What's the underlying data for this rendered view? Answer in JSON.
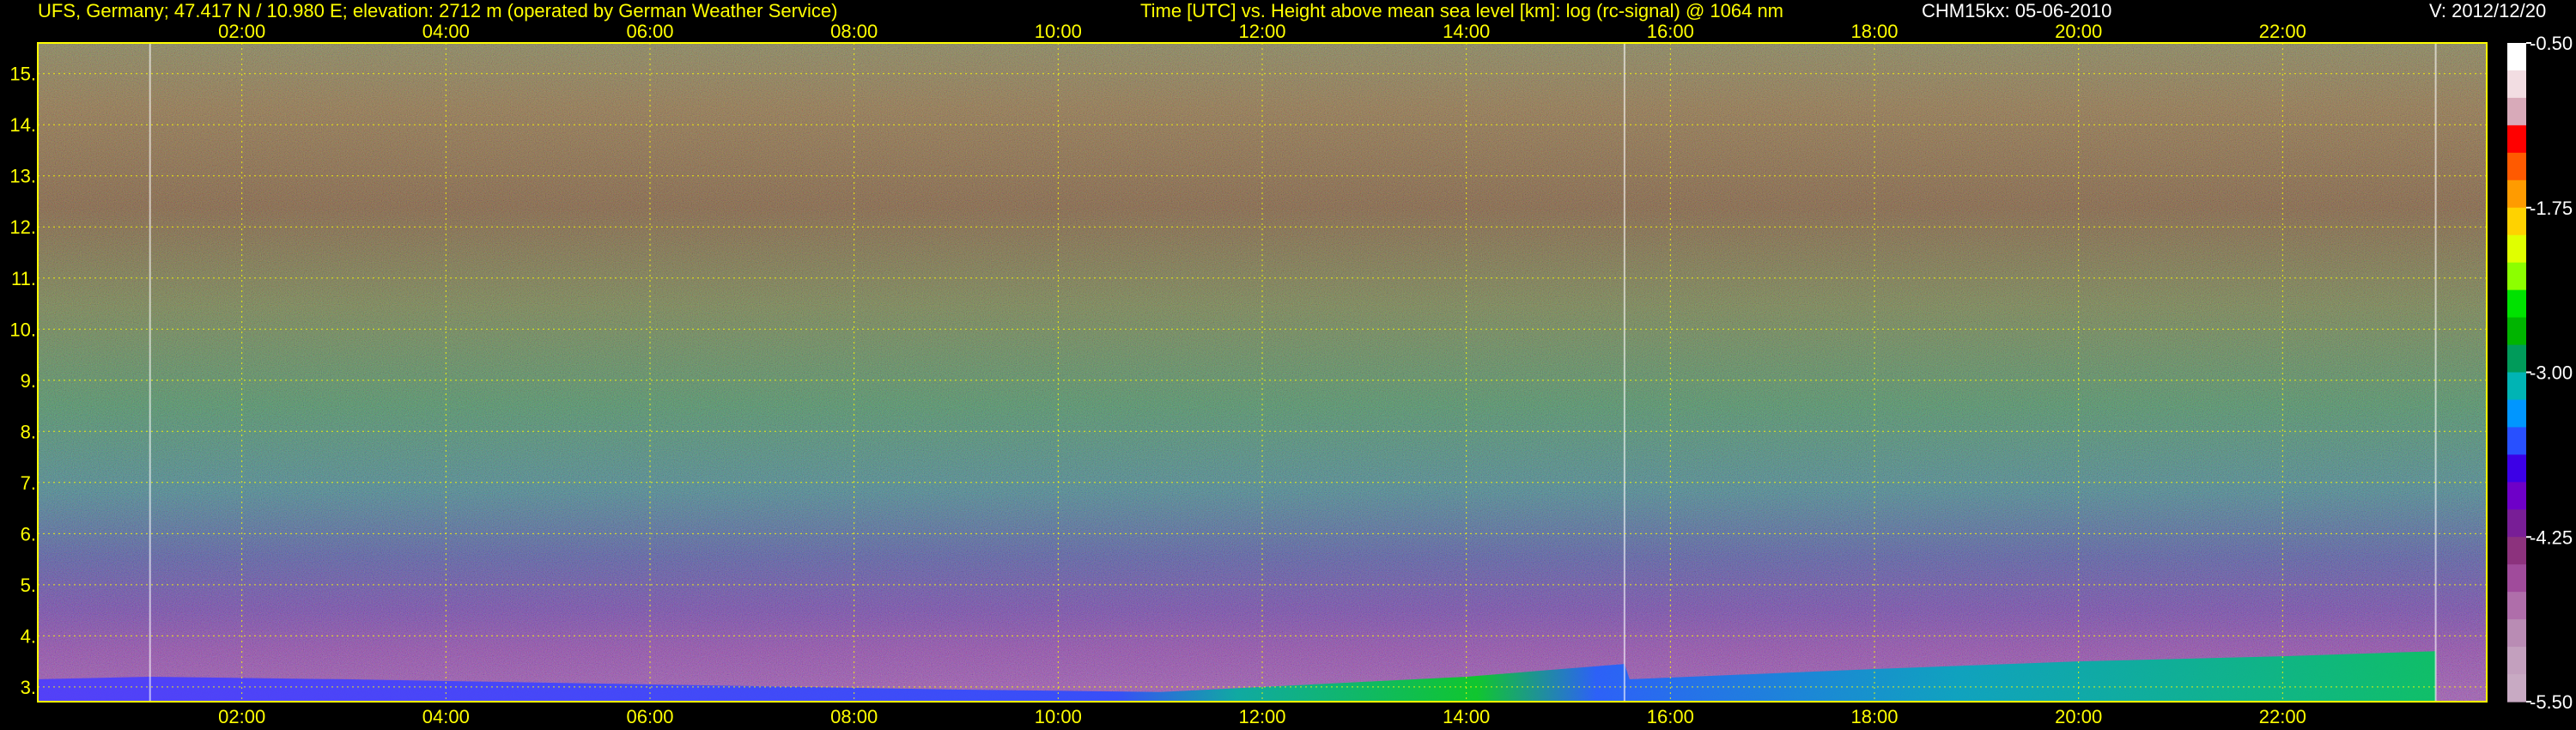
{
  "header": {
    "station": "UFS, Germany; 47.417 N / 10.980 E; elevation: 2712 m  (operated by German Weather Service)",
    "plot_title": "Time [UTC] vs. Height above mean sea level [km]: log (rc-signal) @ 1064 nm",
    "instrument": "CHM15kx: 05-06-2010",
    "version": "V: 2012/12/20"
  },
  "colors": {
    "background": "#000000",
    "text_primary": "#ffff00",
    "text_secondary": "#ffffff",
    "grid": "#ffff00"
  },
  "chart_data": {
    "type": "heatmap",
    "title": "Time [UTC] vs. Height above mean sea level [km]: log (rc-signal) @ 1064 nm",
    "xlabel": "Time [UTC]",
    "ylabel": "Height above mean sea level [km]",
    "x_unit": "hour UTC",
    "xlim": [
      0,
      24
    ],
    "x_ticks": [
      2,
      4,
      6,
      8,
      10,
      12,
      14,
      16,
      18,
      20,
      22
    ],
    "x_tick_labels": [
      "02:00",
      "04:00",
      "06:00",
      "08:00",
      "10:00",
      "12:00",
      "14:00",
      "16:00",
      "18:00",
      "20:00",
      "22:00"
    ],
    "ylim": [
      2.712,
      15.6
    ],
    "y_ticks": [
      3,
      4,
      5,
      6,
      7,
      8,
      9,
      10,
      11,
      12,
      13,
      14,
      15
    ],
    "y_tick_labels": [
      "3.",
      "4.",
      "5.",
      "6.",
      "7.",
      "8.",
      "9.",
      "10.",
      "11.",
      "12.",
      "13.",
      "14.",
      "15."
    ],
    "grid": true,
    "colorbar": {
      "range": [
        -5.5,
        -0.5
      ],
      "tick_values": [
        -0.5,
        -1.75,
        -3.0,
        -4.25,
        -5.5
      ],
      "tick_labels": [
        "-0.50",
        "-1.75",
        "-3.00",
        "-4.25",
        "-5.50"
      ],
      "colors_top_to_bottom": [
        "#ffffff",
        "#f2dde2",
        "#d8aab9",
        "#ff0000",
        "#ff5a00",
        "#ff9b00",
        "#ffd200",
        "#e0ff00",
        "#8cff00",
        "#00e200",
        "#00b400",
        "#009b5a",
        "#00b4b4",
        "#0096ff",
        "#2850ff",
        "#3c00e6",
        "#6e00c8",
        "#781e96",
        "#8c327d",
        "#a04b9b",
        "#af6eaa",
        "#b98cb4",
        "#c3a0be",
        "#c8aac3"
      ]
    },
    "features": {
      "boundary_layer_top_km": [
        {
          "time": 0.0,
          "height": 3.15
        },
        {
          "time": 1.1,
          "height": 3.2
        },
        {
          "time": 3.0,
          "height": 3.15
        },
        {
          "time": 6.0,
          "height": 3.05
        },
        {
          "time": 9.0,
          "height": 2.95
        },
        {
          "time": 11.0,
          "height": 2.9
        },
        {
          "time": 12.0,
          "height": 3.0
        },
        {
          "time": 14.0,
          "height": 3.2
        },
        {
          "time": 15.55,
          "height": 3.45
        },
        {
          "time": 15.6,
          "height": 3.15
        },
        {
          "time": 18.0,
          "height": 3.35
        },
        {
          "time": 20.0,
          "height": 3.5
        },
        {
          "time": 22.0,
          "height": 3.6
        },
        {
          "time": 23.5,
          "height": 3.7
        }
      ],
      "data_gaps_hours": [
        1.1,
        15.55,
        23.5
      ]
    }
  }
}
